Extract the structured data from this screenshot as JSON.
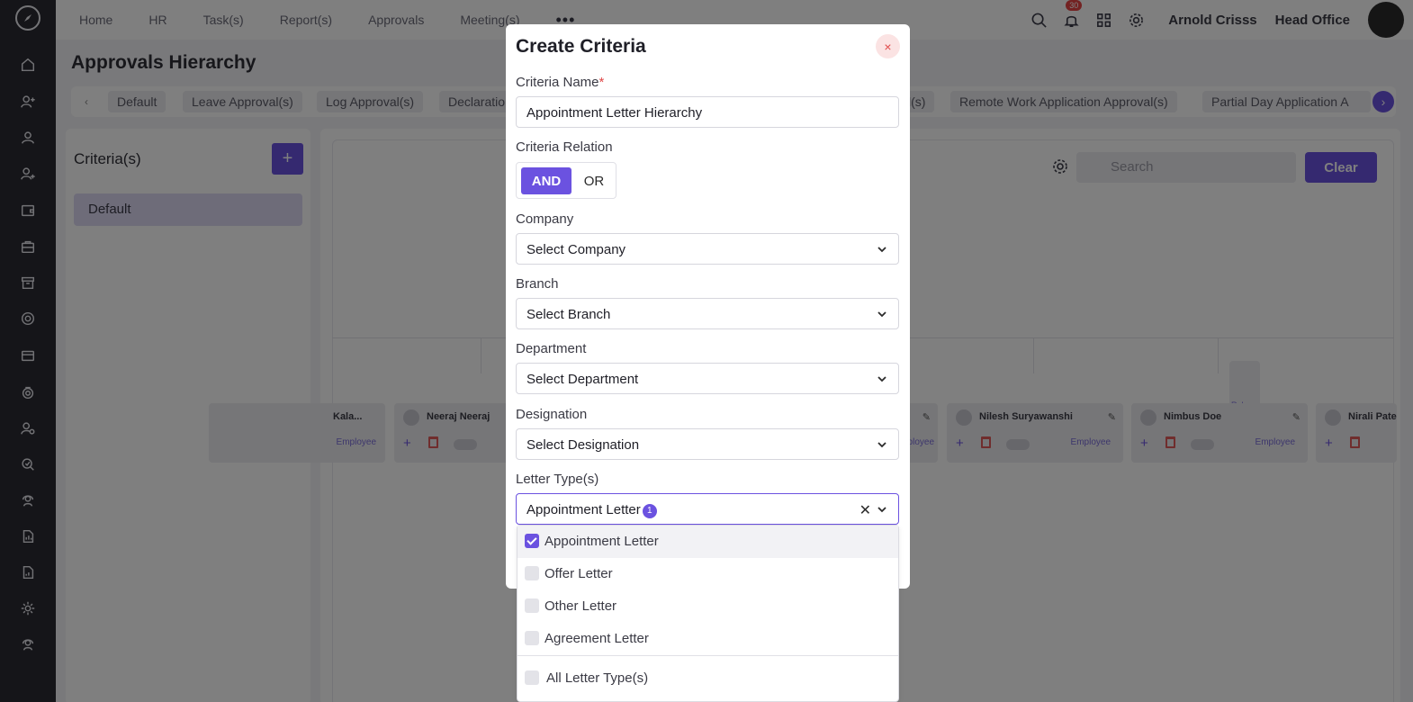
{
  "topbar": {
    "nav": [
      "Home",
      "HR",
      "Task(s)",
      "Report(s)",
      "Approvals",
      "Meeting(s)"
    ],
    "more": "•••",
    "notification_count": "30",
    "user_name": "Arnold Crisss",
    "office": "Head Office"
  },
  "page": {
    "title": "Approvals Hierarchy",
    "tabs": [
      "Default",
      "Leave Approval(s)",
      "Log Approval(s)",
      "Declaratio",
      "l(s)",
      "Remote Work Application Approval(s)",
      "Partial Day Application A"
    ]
  },
  "criteria_panel": {
    "title": "Criteria(s)",
    "add_label": "+",
    "items": [
      "Default"
    ]
  },
  "main": {
    "search_placeholder": "Search",
    "clear_label": "Clear",
    "top_node_role": "Role",
    "nodes": [
      {
        "name": "Kala...",
        "role": "Employee"
      },
      {
        "name": "Neeraj Neeraj",
        "role": ""
      },
      {
        "name": "Nilesh Suryawanshi",
        "role": "Employee"
      },
      {
        "name": "Nimbus Doe",
        "role": "Employee"
      },
      {
        "name": "Nirali Pate",
        "role": ""
      }
    ],
    "partial_role": "Employee"
  },
  "modal": {
    "title": "Create Criteria",
    "close_label": "×",
    "criteria_name_label": "Criteria Name",
    "criteria_name_value": "Appointment Letter Hierarchy",
    "relation_label": "Criteria Relation",
    "relation_and": "AND",
    "relation_or": "OR",
    "company_label": "Company",
    "company_value": "Select Company",
    "branch_label": "Branch",
    "branch_value": "Select Branch",
    "department_label": "Department",
    "department_value": "Select Department",
    "designation_label": "Designation",
    "designation_value": "Select Designation",
    "letter_label": "Letter Type(s)",
    "letter_value": "Appointment Letter",
    "letter_count": "1",
    "letter_options": [
      {
        "label": "Appointment Letter",
        "checked": true
      },
      {
        "label": "Offer Letter",
        "checked": false
      },
      {
        "label": "Other Letter",
        "checked": false
      },
      {
        "label": "Agreement Letter",
        "checked": false
      }
    ],
    "all_option": "All Letter Type(s)"
  },
  "colors": {
    "accent": "#6b52e0",
    "sidebar": "#2a2a33",
    "danger": "#e04848"
  }
}
